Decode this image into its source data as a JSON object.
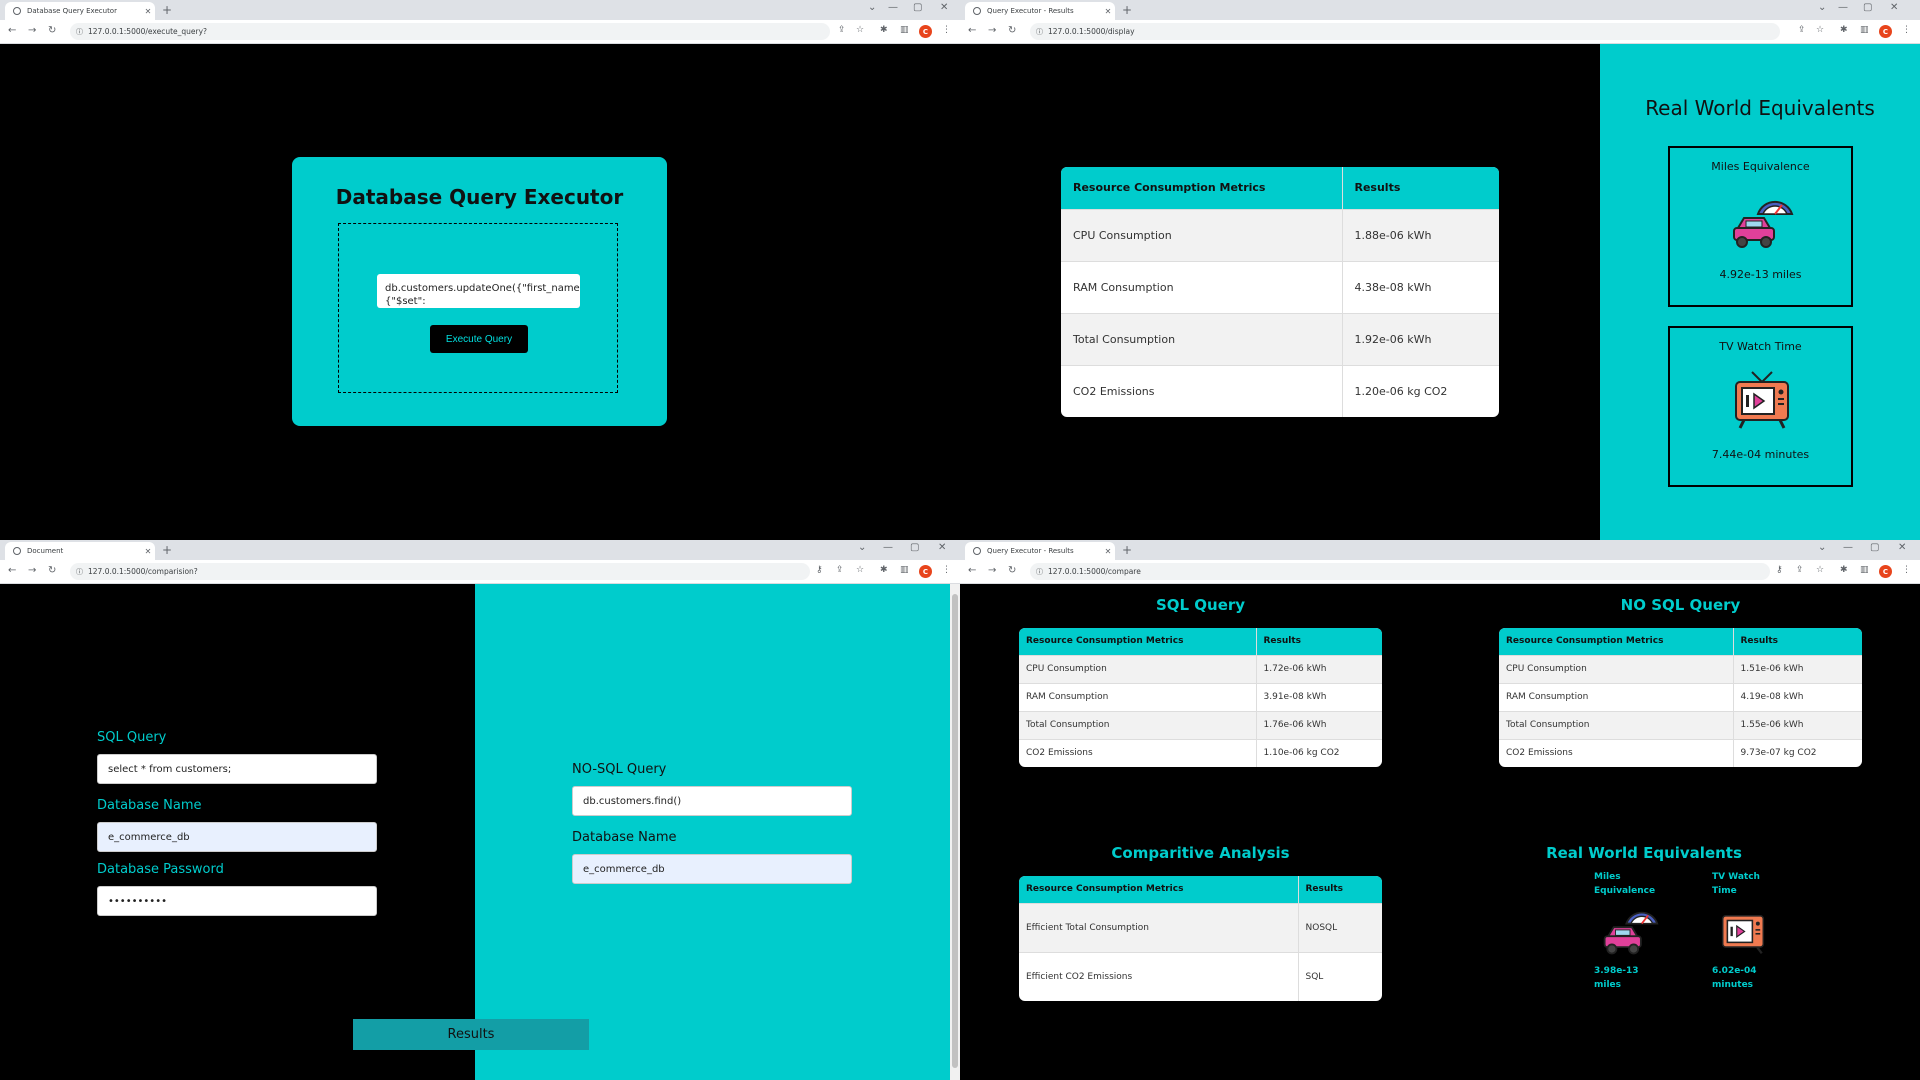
{
  "windows": {
    "w1": {
      "tab_title": "Database Query Executor",
      "url": "127.0.0.1:5000/execute_query?",
      "page": {
        "heading": "Database Query Executor",
        "query_text": "db.customers.updateOne({\"first_name\":\"John\"}, {\"$set\":",
        "execute_label": "Execute Query"
      }
    },
    "w2": {
      "tab_title": "Query Executor - Results",
      "url": "127.0.0.1:5000/display",
      "page": {
        "table": {
          "headers": [
            "Resource Consumption Metrics",
            "Results"
          ],
          "rows": [
            [
              "CPU Consumption",
              "1.88e-06 kWh"
            ],
            [
              "RAM Consumption",
              "4.38e-08 kWh"
            ],
            [
              "Total Consumption",
              "1.92e-06 kWh"
            ],
            [
              "CO2 Emissions",
              "1.20e-06 kg CO2"
            ]
          ]
        },
        "rw_title": "Real World Equivalents",
        "miles_label": "Miles Equivalence",
        "miles_value": "4.92e-13 miles",
        "tv_label": "TV Watch Time",
        "tv_value": "7.44e-04 minutes"
      }
    },
    "w3": {
      "tab_title": "Document",
      "url": "127.0.0.1:5000/comparision?",
      "page": {
        "sql_label": "SQL Query",
        "sql_value": "select * from customers;",
        "dbname_label": "Database Name",
        "dbname_value": "e_commerce_db",
        "dbpass_label": "Database Password",
        "dbpass_value": "••••••••••",
        "nosql_label": "NO-SQL Query",
        "nosql_value": "db.customers.find()",
        "nosql_dbname_label": "Database Name",
        "nosql_dbname_value": "e_commerce_db",
        "results_label": "Results"
      }
    },
    "w4": {
      "tab_title": "Query Executor - Results",
      "url": "127.0.0.1:5000/compare",
      "page": {
        "sql_title": "SQL Query",
        "nosql_title": "NO SQL Query",
        "sql_table": {
          "headers": [
            "Resource Consumption Metrics",
            "Results"
          ],
          "rows": [
            [
              "CPU Consumption",
              "1.72e-06 kWh"
            ],
            [
              "RAM Consumption",
              "3.91e-08 kWh"
            ],
            [
              "Total Consumption",
              "1.76e-06 kWh"
            ],
            [
              "CO2 Emissions",
              "1.10e-06 kg CO2"
            ]
          ]
        },
        "nosql_table": {
          "headers": [
            "Resource Consumption Metrics",
            "Results"
          ],
          "rows": [
            [
              "CPU Consumption",
              "1.51e-06 kWh"
            ],
            [
              "RAM Consumption",
              "4.19e-08 kWh"
            ],
            [
              "Total Consumption",
              "1.55e-06 kWh"
            ],
            [
              "CO2 Emissions",
              "9.73e-07 kg CO2"
            ]
          ]
        },
        "comp_title": "Comparitive Analysis",
        "comp_table": {
          "headers": [
            "Resource Consumption Metrics",
            "Results"
          ],
          "rows": [
            [
              "Efficient Total Consumption",
              "NOSQL"
            ],
            [
              "Efficient CO2 Emissions",
              "SQL"
            ]
          ]
        },
        "rw_title": "Real World Equivalents",
        "miles_label": "Miles Equivalence",
        "miles_value": "3.98e-13 miles",
        "tv_label": "TV Watch Time",
        "tv_value": "6.02e-04 minutes"
      }
    }
  },
  "colors": {
    "accent": "#00cccc",
    "button_dark": "#000000",
    "results_button": "#139ea6",
    "profile": "#e8441c"
  },
  "icons": [
    "globe-icon",
    "close-icon",
    "plus-icon",
    "back-icon",
    "forward-icon",
    "reload-icon",
    "share-icon",
    "star-icon",
    "extensions-icon",
    "sidebar-icon",
    "key-icon",
    "menu-icon",
    "car-speedometer-icon",
    "tv-icon"
  ],
  "profile_initial": "C"
}
